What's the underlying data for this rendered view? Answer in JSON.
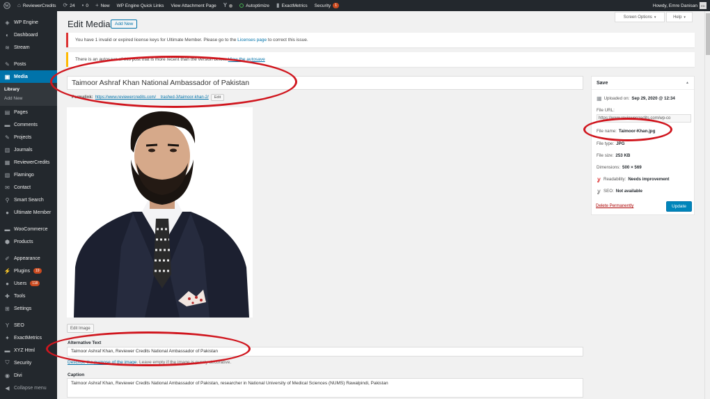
{
  "admin_bar": {
    "site_name": "ReviewerCredits",
    "updates_count": "24",
    "comments_count": "0",
    "new_label": "New",
    "wp_engine_links": "WP Engine Quick Links",
    "view_attachment": "View Attachment Page",
    "autoptimize": "Autoptimize",
    "exactmetrics": "ExactMetrics",
    "security": "Security",
    "security_badge": "1",
    "howdy": "Howdy, Emre Danisan",
    "avatar_initials": "ED"
  },
  "sidebar": {
    "items": [
      {
        "label": "WP Engine",
        "icon": "wp-engine-icon"
      },
      {
        "label": "Dashboard",
        "icon": "dashboard-icon"
      },
      {
        "label": "Stream",
        "icon": "stream-icon"
      },
      {
        "label": "Posts",
        "icon": "pin-icon"
      },
      {
        "label": "Media",
        "icon": "media-icon"
      },
      {
        "label": "Pages",
        "icon": "page-icon"
      },
      {
        "label": "Comments",
        "icon": "comment-icon"
      },
      {
        "label": "Projects",
        "icon": "pin-icon"
      },
      {
        "label": "Journals",
        "icon": "journal-icon"
      },
      {
        "label": "ReviewerCredits",
        "icon": "list-icon"
      },
      {
        "label": "Flamingo",
        "icon": "flamingo-icon"
      },
      {
        "label": "Contact",
        "icon": "mail-icon"
      },
      {
        "label": "Smart Search",
        "icon": "search-icon"
      },
      {
        "label": "Ultimate Member",
        "icon": "user-icon"
      },
      {
        "label": "WooCommerce",
        "icon": "woo-icon"
      },
      {
        "label": "Products",
        "icon": "box-icon"
      },
      {
        "label": "Appearance",
        "icon": "brush-icon"
      },
      {
        "label": "Plugins",
        "icon": "plugin-icon",
        "badge": "19"
      },
      {
        "label": "Users",
        "icon": "users-icon",
        "badge": "118"
      },
      {
        "label": "Tools",
        "icon": "wrench-icon"
      },
      {
        "label": "Settings",
        "icon": "settings-icon"
      },
      {
        "label": "SEO",
        "icon": "yoast-icon"
      },
      {
        "label": "ExactMetrics",
        "icon": "chart-icon"
      },
      {
        "label": "XYZ Html",
        "icon": "code-icon"
      },
      {
        "label": "Security",
        "icon": "shield-icon"
      },
      {
        "label": "Divi",
        "icon": "divi-icon"
      },
      {
        "label": "Collapse menu",
        "icon": "collapse-icon"
      }
    ],
    "submenu": {
      "library": "Library",
      "add_new": "Add New"
    }
  },
  "screen_options": "Screen Options",
  "help": "Help",
  "page": {
    "title": "Edit Media",
    "add_new": "Add New"
  },
  "notices": {
    "license_pre": "You have 1 invalid or expired license keys for Ultimate Member. Please go to the ",
    "license_link": "Licenses page",
    "license_post": " to correct this issue.",
    "autosave_pre": "There is an autosave of this post that is more recent than the version below.",
    "autosave_link": "View the autosave"
  },
  "post": {
    "title": "Taimoor Ashraf Khan National Ambassador of Pakistan",
    "permalink_label": "Permalink:",
    "permalink_url": "https://www.reviewercredits.com/__trashed-3/taimoor-khan-2/",
    "permalink_edit": "Edit",
    "edit_image": "Edit Image",
    "alt_label": "Alternative Text",
    "alt_value": "Taimoor Ashraf Khan, Reviewer Credits National Ambassador of Pakistan",
    "alt_help_link": "Describe the purpose of the image",
    "alt_help_text": ". Leave empty if the image is purely decorative.",
    "caption_label": "Caption",
    "caption_value": "Taimoor Ashraf Khan, Reviewer Credits National Ambassador of Pakistan, researcher in National University of Medical Sciences (NUMS) Rawalpindi, Pakistan"
  },
  "save_box": {
    "title": "Save",
    "uploaded_label": "Uploaded on:",
    "uploaded_value": "Sep 29, 2020 @ 12:34",
    "file_url_label": "File URL:",
    "file_url_value": "https://www.reviewercredits.com/wp-co",
    "file_name_label": "File name:",
    "file_name_value": "Taimoor-Khan.jpg",
    "file_type_label": "File type:",
    "file_type_value": "JPG",
    "file_size_label": "File size:",
    "file_size_value": "253 KB",
    "dimensions_label": "Dimensions:",
    "dimensions_value": "500 × 569",
    "readability_label": "Readability:",
    "readability_value": "Needs improvement",
    "seo_label": "SEO:",
    "seo_value": "Not available",
    "delete": "Delete Permanently",
    "update": "Update"
  },
  "colors": {
    "admin_bar": "#23282d",
    "accent": "#0073aa",
    "annotation": "#d0161e",
    "update_button": "#0085ba"
  }
}
